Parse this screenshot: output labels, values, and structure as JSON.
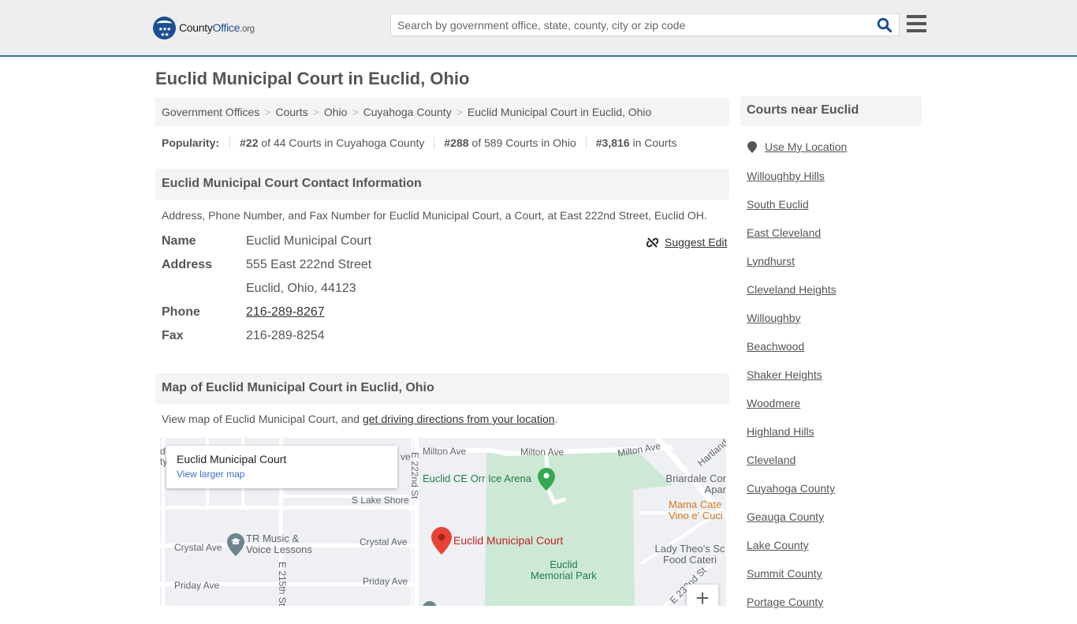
{
  "header": {
    "logo": {
      "county": "County",
      "office": "Office",
      "org": ".org"
    },
    "search_placeholder": "Search by government office, state, county, city or zip code",
    "colors": {
      "brand_blue": "#1a4f94",
      "accent_border": "#2f74b5"
    }
  },
  "page": {
    "title": "Euclid Municipal Court in Euclid, Ohio"
  },
  "breadcrumb": [
    {
      "label": "Government Offices"
    },
    {
      "label": "Courts"
    },
    {
      "label": "Ohio"
    },
    {
      "label": "Cuyahoga County"
    },
    {
      "label": "Euclid Municipal Court in Euclid, Ohio"
    }
  ],
  "breadcrumb_separator": ">",
  "popularity": {
    "label": "Popularity:",
    "items": [
      {
        "rank": "#22",
        "text": " of 44 Courts in Cuyahoga County"
      },
      {
        "rank": "#288",
        "text": " of 589 Courts in Ohio"
      },
      {
        "rank": "#3,816",
        "text": " in Courts"
      }
    ]
  },
  "contact": {
    "heading": "Euclid Municipal Court Contact Information",
    "description": "Address, Phone Number, and Fax Number for Euclid Municipal Court, a Court, at East 222nd Street, Euclid OH.",
    "suggest_edit": "Suggest Edit",
    "fields": {
      "name_label": "Name",
      "name_value": "Euclid Municipal Court",
      "address_label": "Address",
      "address_line1": "555 East 222nd Street",
      "address_line2": "Euclid, Ohio, 44123",
      "phone_label": "Phone",
      "phone_value": "216-289-8267",
      "fax_label": "Fax",
      "fax_value": "216-289-8254"
    }
  },
  "map_section": {
    "heading": "Map of Euclid Municipal Court in Euclid, Ohio",
    "desc_prefix": "View map of Euclid Municipal Court, and ",
    "desc_link": "get driving directions from your location",
    "desc_suffix": ".",
    "card_title": "Euclid Municipal Court",
    "card_link": "View larger map",
    "zoom_in": "+",
    "labels": {
      "milton_ave_1": "Milton Ave",
      "milton_ave_2": "Milton Ave",
      "milton_ave_3": "Milton Ave",
      "ave_fragment": "ve",
      "e222": "E 222nd St",
      "e215": "E 215th St",
      "s_lake_shore": "S Lake Shore",
      "crystal_ave_1": "Crystal Ave",
      "crystal_ave_2": "Crystal Ave",
      "priday_ave_1": "Priday Ave",
      "priday_ave_2": "Priday Ave",
      "hartland": "Hartland",
      "e232": "E 232nd St",
      "left_frag_1": "d",
      "left_frag_2": "ty",
      "ice_arena": "Euclid CE Orr Ice Arena",
      "tr_music_1": "TR Music &",
      "tr_music_2": "Voice Lessons",
      "court_marker": "Euclid Municipal Court",
      "park_1": "Euclid",
      "park_2": "Memorial Park",
      "briardale_1": "Briardale Cor",
      "briardale_2": "Apar",
      "mama_1": "Mama Cate",
      "mama_2": "Vino e' Cuci",
      "lady_1": "Lady Theo's Sc",
      "lady_2": "Food Cateri"
    }
  },
  "sidebar": {
    "heading": "Courts near Euclid",
    "use_location": "Use My Location",
    "links": [
      "Willoughby Hills",
      "South Euclid",
      "East Cleveland",
      "Lyndhurst",
      "Cleveland Heights",
      "Willoughby",
      "Beachwood",
      "Shaker Heights",
      "Woodmere",
      "Highland Hills",
      "Cleveland",
      "Cuyahoga County",
      "Geauga County",
      "Lake County",
      "Summit County",
      "Portage County"
    ]
  }
}
